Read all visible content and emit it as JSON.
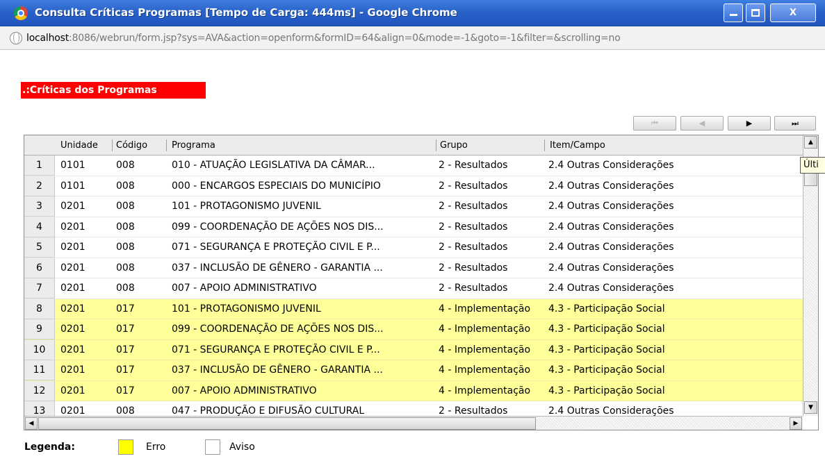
{
  "window": {
    "title": "Consulta Críticas Programas [Tempo de Carga: 444ms] - Google Chrome"
  },
  "address": {
    "host": "localhost",
    "rest": ":8086/webrun/form.jsp?sys=AVA&action=openform&formID=64&align=0&mode=-1&goto=-1&filter=&scrolling=no"
  },
  "section_title": ".:Críticas dos Programas",
  "pager": {
    "first": "⏮",
    "prev": "◀",
    "next": "▶",
    "last": "⏭"
  },
  "grid": {
    "headers": [
      "Unidade",
      "Código",
      "Programa",
      "Grupo",
      "Item/Campo"
    ],
    "rows": [
      {
        "n": "1",
        "unidade": "0101",
        "codigo": "008",
        "programa": "010 - ATUAÇÃO LEGISLATIVA DA CÂMAR...",
        "grupo": "2 - Resultados",
        "item": "2.4 Outras Considerações",
        "type": "warn"
      },
      {
        "n": "2",
        "unidade": "0101",
        "codigo": "008",
        "programa": "000 - ENCARGOS ESPECIAIS DO MUNICÍPIO",
        "grupo": "2 - Resultados",
        "item": "2.4 Outras Considerações",
        "type": "warn"
      },
      {
        "n": "3",
        "unidade": "0201",
        "codigo": "008",
        "programa": "101 - PROTAGONISMO JUVENIL",
        "grupo": "2 - Resultados",
        "item": "2.4 Outras Considerações",
        "type": "warn"
      },
      {
        "n": "4",
        "unidade": "0201",
        "codigo": "008",
        "programa": "099 - COORDENAÇÃO DE AÇÕES NOS DIS...",
        "grupo": "2 - Resultados",
        "item": "2.4 Outras Considerações",
        "type": "warn"
      },
      {
        "n": "5",
        "unidade": "0201",
        "codigo": "008",
        "programa": "071 - SEGURANÇA E PROTEÇÃO CIVIL E P...",
        "grupo": "2 - Resultados",
        "item": "2.4 Outras Considerações",
        "type": "warn"
      },
      {
        "n": "6",
        "unidade": "0201",
        "codigo": "008",
        "programa": "037 - INCLUSÃO DE GÊNERO - GARANTIA ...",
        "grupo": "2 - Resultados",
        "item": "2.4 Outras Considerações",
        "type": "warn"
      },
      {
        "n": "7",
        "unidade": "0201",
        "codigo": "008",
        "programa": "007 - APOIO ADMINISTRATIVO",
        "grupo": "2 - Resultados",
        "item": "2.4 Outras Considerações",
        "type": "warn"
      },
      {
        "n": "8",
        "unidade": "0201",
        "codigo": "017",
        "programa": "101 - PROTAGONISMO JUVENIL",
        "grupo": "4 - Implementação",
        "item": "4.3 - Participação Social",
        "type": "err"
      },
      {
        "n": "9",
        "unidade": "0201",
        "codigo": "017",
        "programa": "099 - COORDENAÇÃO DE AÇÕES NOS DIS...",
        "grupo": "4 - Implementação",
        "item": "4.3 - Participação Social",
        "type": "err"
      },
      {
        "n": "10",
        "unidade": "0201",
        "codigo": "017",
        "programa": "071 - SEGURANÇA E PROTEÇÃO CIVIL E P...",
        "grupo": "4 - Implementação",
        "item": "4.3 - Participação Social",
        "type": "err"
      },
      {
        "n": "11",
        "unidade": "0201",
        "codigo": "017",
        "programa": "037 - INCLUSÃO DE GÊNERO - GARANTIA ...",
        "grupo": "4 - Implementação",
        "item": "4.3 - Participação Social",
        "type": "err"
      },
      {
        "n": "12",
        "unidade": "0201",
        "codigo": "017",
        "programa": "007 - APOIO ADMINISTRATIVO",
        "grupo": "4 - Implementação",
        "item": "4.3 - Participação Social",
        "type": "err"
      },
      {
        "n": "13",
        "unidade": "0201",
        "codigo": "008",
        "programa": "047 - PRODUÇÃO E DIFUSÃO CULTURAL",
        "grupo": "2 - Resultados",
        "item": "2.4 Outras Considerações",
        "type": "warn"
      }
    ]
  },
  "tooltip": "Últi",
  "legend": {
    "label": "Legenda:",
    "error": "Erro",
    "warning": "Aviso",
    "error_color": "#ffff00",
    "warning_color": "#ffffff"
  }
}
